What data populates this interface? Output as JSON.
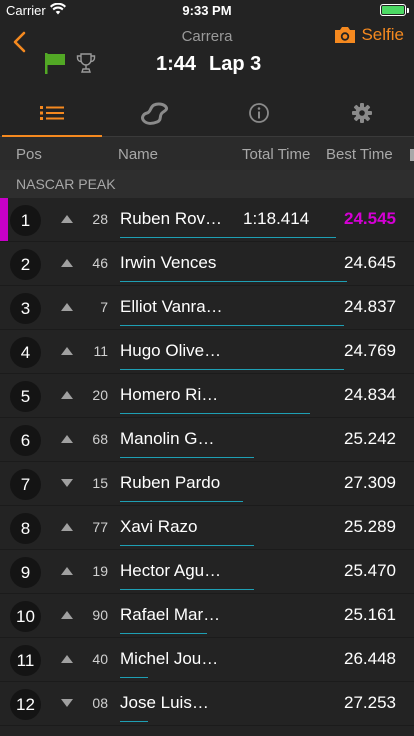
{
  "status_bar": {
    "carrier": "Carrier",
    "time": "9:33 PM",
    "battery_level": 1.0
  },
  "header": {
    "session_name": "Carrera",
    "race_clock": "1:44",
    "lap_label": "Lap 3",
    "selfie_label": "Selfie",
    "accent_color": "#f5891f"
  },
  "tabs": [
    {
      "icon": "list-icon",
      "active": true
    },
    {
      "icon": "track-icon",
      "active": false
    },
    {
      "icon": "info-icon",
      "active": false
    },
    {
      "icon": "gear-icon",
      "active": false
    }
  ],
  "columns": {
    "pos": "Pos",
    "name": "Name",
    "total": "Total Time",
    "best": "Best Time"
  },
  "group_label": "NASCAR PEAK",
  "rows": [
    {
      "pos": "1",
      "trend": "up",
      "car": "28",
      "name": "Ruben Rov…",
      "total": "1:18.414",
      "best": "24.545",
      "fastest": true,
      "progress": 0.77
    },
    {
      "pos": "2",
      "trend": "up",
      "car": "46",
      "name": "Irwin Vences",
      "total": "",
      "best": "24.645",
      "fastest": false,
      "progress": 0.81
    },
    {
      "pos": "3",
      "trend": "up",
      "car": "7",
      "name": "Elliot Vanra…",
      "total": "",
      "best": "24.837",
      "fastest": false,
      "progress": 0.8
    },
    {
      "pos": "4",
      "trend": "up",
      "car": "11",
      "name": "Hugo Olive…",
      "total": "",
      "best": "24.769",
      "fastest": false,
      "progress": 0.8
    },
    {
      "pos": "5",
      "trend": "up",
      "car": "20",
      "name": "Homero Ri…",
      "total": "",
      "best": "24.834",
      "fastest": false,
      "progress": 0.68
    },
    {
      "pos": "6",
      "trend": "up",
      "car": "68",
      "name": "Manolin G…",
      "total": "",
      "best": "25.242",
      "fastest": false,
      "progress": 0.48
    },
    {
      "pos": "7",
      "trend": "down",
      "car": "15",
      "name": "Ruben Pardo",
      "total": "",
      "best": "27.309",
      "fastest": false,
      "progress": 0.44
    },
    {
      "pos": "8",
      "trend": "up",
      "car": "77",
      "name": "Xavi Razo",
      "total": "",
      "best": "25.289",
      "fastest": false,
      "progress": 0.48
    },
    {
      "pos": "9",
      "trend": "up",
      "car": "19",
      "name": "Hector Agu…",
      "total": "",
      "best": "25.470",
      "fastest": false,
      "progress": 0.48
    },
    {
      "pos": "10",
      "trend": "up",
      "car": "90",
      "name": "Rafael Mar…",
      "total": "",
      "best": "25.161",
      "fastest": false,
      "progress": 0.31
    },
    {
      "pos": "11",
      "trend": "up",
      "car": "40",
      "name": "Michel Jou…",
      "total": "",
      "best": "26.448",
      "fastest": false,
      "progress": 0.1
    },
    {
      "pos": "12",
      "trend": "down",
      "car": "08",
      "name": "Jose Luis…",
      "total": "",
      "best": "27.253",
      "fastest": false,
      "progress": 0.1
    }
  ]
}
